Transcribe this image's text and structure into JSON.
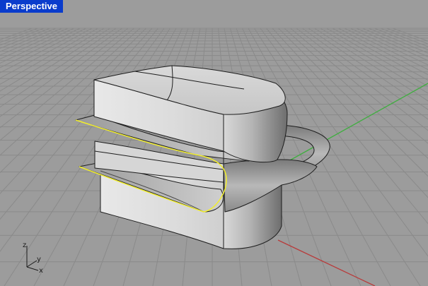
{
  "viewport": {
    "title": "Perspective"
  },
  "axis_widget": {
    "z": "z",
    "y": "y",
    "x": "x"
  },
  "colors": {
    "background": "#9c9c9c",
    "grid": "#8c8c8c",
    "x_axis": "#b83b3b",
    "y_axis": "#3fae3f",
    "selection": "#f2ee2e",
    "title_bar": "#0a3ccc"
  }
}
